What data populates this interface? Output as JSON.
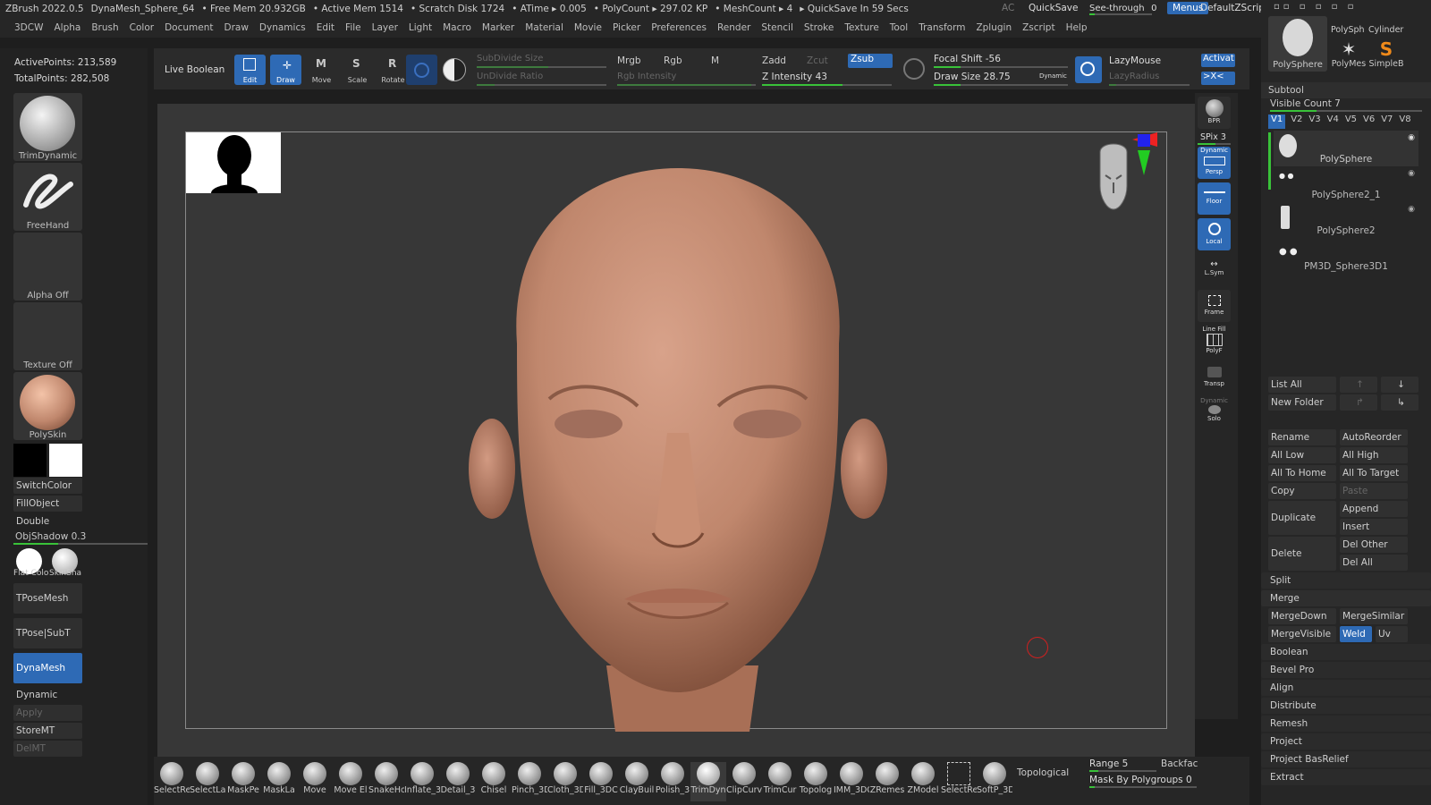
{
  "titlebar": {
    "app": "ZBrush 2022.0.5",
    "doc": "DynaMesh_Sphere_64",
    "free_mem": "• Free Mem 20.932GB",
    "active_mem": "• Active Mem 1514",
    "scratch": "• Scratch Disk 1724",
    "atime": "• ATime ▸ 0.005",
    "polycount": "• PolyCount ▸ 297.02 KP",
    "meshcount": "• MeshCount ▸ 4",
    "quicksave_in": "▸ QuickSave In 59 Secs",
    "ac": "AC",
    "quicksave": "QuickSave",
    "see_through": "See-through",
    "see_through_val": "0",
    "menus": "Menus",
    "zscript": "DefaultZScript"
  },
  "menubar": [
    "3DCW",
    "Alpha",
    "Brush",
    "Color",
    "Document",
    "Draw",
    "Dynamics",
    "Edit",
    "File",
    "Layer",
    "Light",
    "Macro",
    "Marker",
    "Material",
    "Movie",
    "Picker",
    "Preferences",
    "Render",
    "Stencil",
    "Stroke",
    "Texture",
    "Tool",
    "Transform",
    "Zplugin",
    "Zscript",
    "Help"
  ],
  "stats": {
    "active_points": "ActivePoints: 213,589",
    "total_points": "TotalPoints: 282,508"
  },
  "left": {
    "trimdynamic": "TrimDynamic",
    "freehand": "FreeHand",
    "alpha_off": "Alpha Off",
    "texture_off": "Texture Off",
    "polyskin": "PolySkin",
    "switchcolor": "SwitchColor",
    "fillobject": "FillObject",
    "double": "Double",
    "objshadow": "ObjShadow",
    "objshadow_val": "0.3",
    "flat_color": "Flat Colo",
    "skinshade": "SkinSha",
    "tposemesh": "TPoseMesh",
    "tpose_subt": "TPose|SubT",
    "dynamesh": "DynaMesh",
    "dynamic": "Dynamic",
    "apply": "Apply",
    "storemt": "StoreMT",
    "delmt": "DelMT"
  },
  "shelf": {
    "live_boolean": "Live Boolean",
    "edit": "Edit",
    "draw": "Draw",
    "move": "Move",
    "scale": "Scale",
    "rotate": "Rotate",
    "subdivide_size": "SubDivide Size",
    "undivide_ratio": "UnDivide Ratio",
    "mrgb": "Mrgb",
    "rgb": "Rgb",
    "m": "M",
    "rgb_intensity": "Rgb Intensity",
    "zadd": "Zadd",
    "zcut": "Zcut",
    "zsub": "Zsub",
    "z_intensity": "Z Intensity 43",
    "focal_shift": "Focal Shift -56",
    "draw_size": "Draw Size 28.75",
    "dynamic": "Dynamic",
    "lazymouse": "LazyMouse",
    "lazyradius": "LazyRadius",
    "activate": "Activat",
    "x_sym": ">X<"
  },
  "rightstrip": {
    "bpr": "BPR",
    "spix": "SPix 3",
    "persp": "Persp",
    "dynamic": "Dynamic",
    "floor": "Floor",
    "local": "Local",
    "lsym": "L.Sym",
    "frame": "Frame",
    "linefill": "Line Fill",
    "polyf": "PolyF",
    "transp": "Transp",
    "solo": "Solo",
    "dynamic2": "Dynamic"
  },
  "tools": {
    "polysphere": "PolySphere",
    "polysph": "PolySph",
    "cylinder": "Cylinder",
    "polymesh": "PolyMes",
    "simpleb": "SimpleB"
  },
  "subtool": {
    "header": "Subtool",
    "visible_count": "Visible Count 7",
    "versions": [
      "V1",
      "V2",
      "V3",
      "V4",
      "V5",
      "V6",
      "V7",
      "V8"
    ],
    "items": [
      "PolySphere",
      "PolySphere2_1",
      "PolySphere2",
      "PM3D_Sphere3D1"
    ],
    "list_all": "List All",
    "new_folder": "New Folder",
    "rename": "Rename",
    "autoreorder": "AutoReorder",
    "all_low": "All Low",
    "all_high": "All High",
    "all_to_home": "All To Home",
    "all_to_target": "All To Target",
    "copy": "Copy",
    "paste": "Paste",
    "duplicate": "Duplicate",
    "append": "Append",
    "insert": "Insert",
    "delete": "Delete",
    "del_other": "Del Other",
    "del_all": "Del All",
    "split": "Split",
    "merge": "Merge",
    "mergedown": "MergeDown",
    "mergesimilar": "MergeSimilar",
    "mergevisible": "MergeVisible",
    "weld": "Weld",
    "uv": "Uv",
    "boolean": "Boolean",
    "bevel_pro": "Bevel Pro",
    "align": "Align",
    "distribute": "Distribute",
    "remesh": "Remesh",
    "project": "Project",
    "project_basrelief": "Project BasRelief",
    "extract": "Extract"
  },
  "bottom": {
    "brushes": [
      "SelectRe",
      "SelectLa",
      "MaskPe",
      "MaskLa",
      "Move",
      "Move El",
      "SnakeHo",
      "Inflate_3",
      "Detail_3",
      "Chisel",
      "Pinch_3D",
      "Cloth_3D",
      "Fill_3DC",
      "ClayBuil",
      "Polish_3",
      "TrimDyn",
      "ClipCurv",
      "TrimCur",
      "Topolog",
      "IMM_3DC",
      "ZRemes",
      "ZModel",
      "SelectRe",
      "SoftP_3D"
    ],
    "topological": "Topological",
    "range": "Range 5",
    "backface": "Backfac",
    "mask_by_polygroups": "Mask By Polygroups",
    "mask_val": "0"
  },
  "colors": {
    "accent": "#2e6ab5",
    "skin": "#c0876d",
    "green": "#39c239"
  }
}
